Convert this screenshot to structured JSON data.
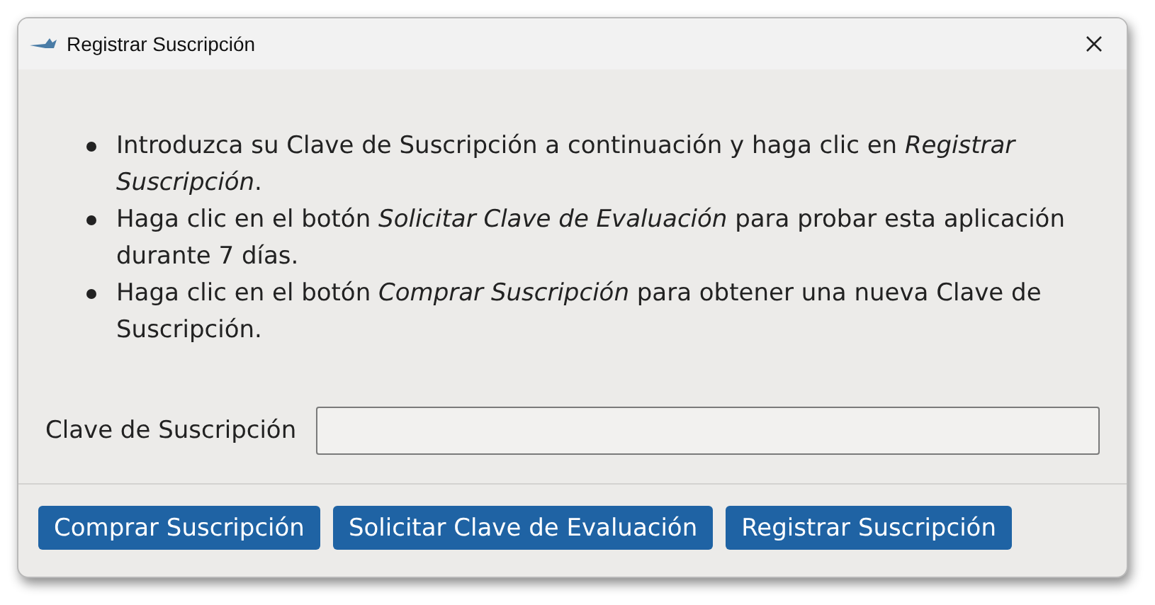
{
  "window": {
    "title": "Registrar Suscripción"
  },
  "instructions": [
    "Introduzca su Clave de Suscripción a continuación y haga clic en *Registrar Suscripción*.",
    "Haga clic en el botón *Solicitar Clave de Evaluación* para probar esta aplicación durante 7 días.",
    "Haga clic en el botón *Comprar Suscripción* para obtener una nueva Clave de Suscripción."
  ],
  "key_field": {
    "label": "Clave de Suscripción"
  },
  "buttons": [
    "Comprar Suscripción",
    "Solicitar Clave de Evaluación",
    "Registrar Suscripción"
  ]
}
